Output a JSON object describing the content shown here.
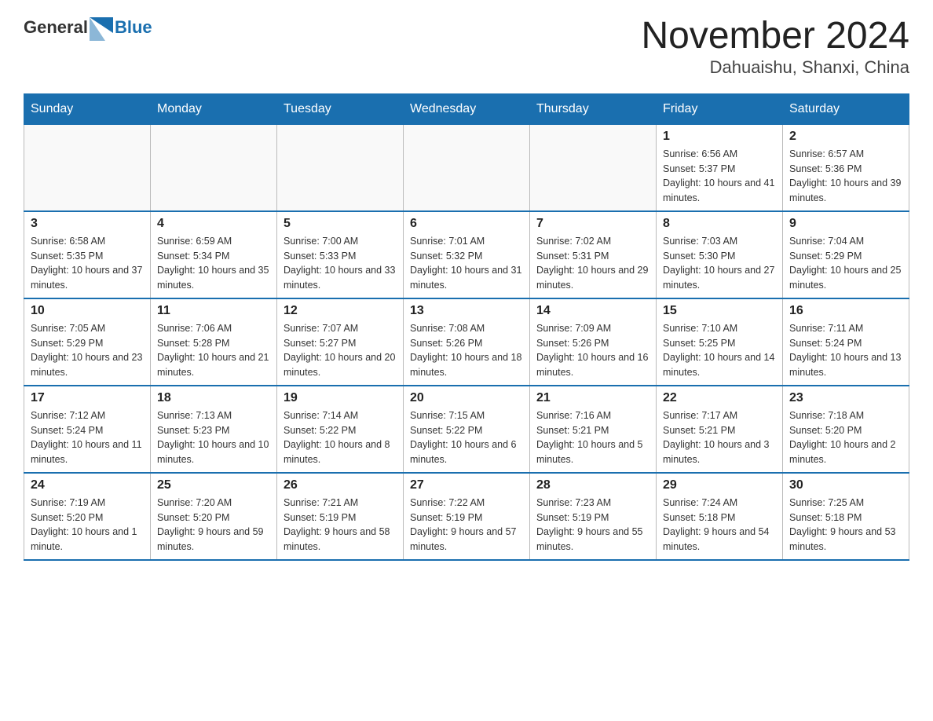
{
  "logo": {
    "general": "General",
    "blue": "Blue"
  },
  "title": "November 2024",
  "subtitle": "Dahuaishu, Shanxi, China",
  "weekdays": [
    "Sunday",
    "Monday",
    "Tuesday",
    "Wednesday",
    "Thursday",
    "Friday",
    "Saturday"
  ],
  "weeks": [
    [
      {
        "day": "",
        "info": ""
      },
      {
        "day": "",
        "info": ""
      },
      {
        "day": "",
        "info": ""
      },
      {
        "day": "",
        "info": ""
      },
      {
        "day": "",
        "info": ""
      },
      {
        "day": "1",
        "info": "Sunrise: 6:56 AM\nSunset: 5:37 PM\nDaylight: 10 hours and 41 minutes."
      },
      {
        "day": "2",
        "info": "Sunrise: 6:57 AM\nSunset: 5:36 PM\nDaylight: 10 hours and 39 minutes."
      }
    ],
    [
      {
        "day": "3",
        "info": "Sunrise: 6:58 AM\nSunset: 5:35 PM\nDaylight: 10 hours and 37 minutes."
      },
      {
        "day": "4",
        "info": "Sunrise: 6:59 AM\nSunset: 5:34 PM\nDaylight: 10 hours and 35 minutes."
      },
      {
        "day": "5",
        "info": "Sunrise: 7:00 AM\nSunset: 5:33 PM\nDaylight: 10 hours and 33 minutes."
      },
      {
        "day": "6",
        "info": "Sunrise: 7:01 AM\nSunset: 5:32 PM\nDaylight: 10 hours and 31 minutes."
      },
      {
        "day": "7",
        "info": "Sunrise: 7:02 AM\nSunset: 5:31 PM\nDaylight: 10 hours and 29 minutes."
      },
      {
        "day": "8",
        "info": "Sunrise: 7:03 AM\nSunset: 5:30 PM\nDaylight: 10 hours and 27 minutes."
      },
      {
        "day": "9",
        "info": "Sunrise: 7:04 AM\nSunset: 5:29 PM\nDaylight: 10 hours and 25 minutes."
      }
    ],
    [
      {
        "day": "10",
        "info": "Sunrise: 7:05 AM\nSunset: 5:29 PM\nDaylight: 10 hours and 23 minutes."
      },
      {
        "day": "11",
        "info": "Sunrise: 7:06 AM\nSunset: 5:28 PM\nDaylight: 10 hours and 21 minutes."
      },
      {
        "day": "12",
        "info": "Sunrise: 7:07 AM\nSunset: 5:27 PM\nDaylight: 10 hours and 20 minutes."
      },
      {
        "day": "13",
        "info": "Sunrise: 7:08 AM\nSunset: 5:26 PM\nDaylight: 10 hours and 18 minutes."
      },
      {
        "day": "14",
        "info": "Sunrise: 7:09 AM\nSunset: 5:26 PM\nDaylight: 10 hours and 16 minutes."
      },
      {
        "day": "15",
        "info": "Sunrise: 7:10 AM\nSunset: 5:25 PM\nDaylight: 10 hours and 14 minutes."
      },
      {
        "day": "16",
        "info": "Sunrise: 7:11 AM\nSunset: 5:24 PM\nDaylight: 10 hours and 13 minutes."
      }
    ],
    [
      {
        "day": "17",
        "info": "Sunrise: 7:12 AM\nSunset: 5:24 PM\nDaylight: 10 hours and 11 minutes."
      },
      {
        "day": "18",
        "info": "Sunrise: 7:13 AM\nSunset: 5:23 PM\nDaylight: 10 hours and 10 minutes."
      },
      {
        "day": "19",
        "info": "Sunrise: 7:14 AM\nSunset: 5:22 PM\nDaylight: 10 hours and 8 minutes."
      },
      {
        "day": "20",
        "info": "Sunrise: 7:15 AM\nSunset: 5:22 PM\nDaylight: 10 hours and 6 minutes."
      },
      {
        "day": "21",
        "info": "Sunrise: 7:16 AM\nSunset: 5:21 PM\nDaylight: 10 hours and 5 minutes."
      },
      {
        "day": "22",
        "info": "Sunrise: 7:17 AM\nSunset: 5:21 PM\nDaylight: 10 hours and 3 minutes."
      },
      {
        "day": "23",
        "info": "Sunrise: 7:18 AM\nSunset: 5:20 PM\nDaylight: 10 hours and 2 minutes."
      }
    ],
    [
      {
        "day": "24",
        "info": "Sunrise: 7:19 AM\nSunset: 5:20 PM\nDaylight: 10 hours and 1 minute."
      },
      {
        "day": "25",
        "info": "Sunrise: 7:20 AM\nSunset: 5:20 PM\nDaylight: 9 hours and 59 minutes."
      },
      {
        "day": "26",
        "info": "Sunrise: 7:21 AM\nSunset: 5:19 PM\nDaylight: 9 hours and 58 minutes."
      },
      {
        "day": "27",
        "info": "Sunrise: 7:22 AM\nSunset: 5:19 PM\nDaylight: 9 hours and 57 minutes."
      },
      {
        "day": "28",
        "info": "Sunrise: 7:23 AM\nSunset: 5:19 PM\nDaylight: 9 hours and 55 minutes."
      },
      {
        "day": "29",
        "info": "Sunrise: 7:24 AM\nSunset: 5:18 PM\nDaylight: 9 hours and 54 minutes."
      },
      {
        "day": "30",
        "info": "Sunrise: 7:25 AM\nSunset: 5:18 PM\nDaylight: 9 hours and 53 minutes."
      }
    ]
  ]
}
